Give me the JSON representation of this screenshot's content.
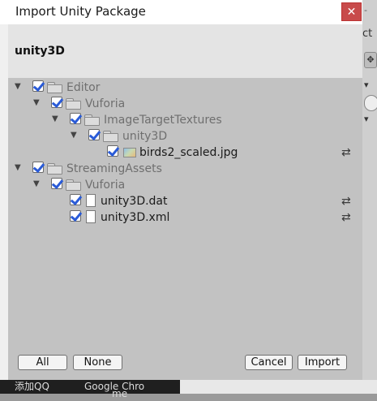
{
  "background": {
    "title_partial": "- ",
    "text_partial": "ct",
    "icon": "move-tool-icon",
    "taskbar": {
      "item_qq": "添加QQ",
      "item_chrome": "Google Chro",
      "item_chrome2": "me"
    }
  },
  "dialog": {
    "title": "Import Unity Package",
    "close_icon": "✕",
    "package_name": "unity3D",
    "tree": [
      {
        "label": "Editor",
        "type": "folder",
        "depth": 0,
        "expanded": true,
        "checked": true,
        "reimport": false
      },
      {
        "label": "Vuforia",
        "type": "folder",
        "depth": 1,
        "expanded": true,
        "checked": true,
        "reimport": false
      },
      {
        "label": "ImageTargetTextures",
        "type": "folder",
        "depth": 2,
        "expanded": true,
        "checked": true,
        "reimport": false
      },
      {
        "label": "unity3D",
        "type": "folder",
        "depth": 3,
        "expanded": true,
        "checked": true,
        "reimport": false
      },
      {
        "label": "birds2_scaled.jpg",
        "type": "image",
        "depth": 4,
        "expanded": false,
        "checked": true,
        "reimport": true
      },
      {
        "label": "StreamingAssets",
        "type": "folder",
        "depth": 0,
        "expanded": true,
        "checked": true,
        "reimport": false
      },
      {
        "label": "Vuforia",
        "type": "folder",
        "depth": 1,
        "expanded": true,
        "checked": true,
        "reimport": false
      },
      {
        "label": "unity3D.dat",
        "type": "file",
        "depth": 2,
        "expanded": false,
        "checked": true,
        "reimport": true
      },
      {
        "label": "unity3D.xml",
        "type": "file",
        "depth": 2,
        "expanded": false,
        "checked": true,
        "reimport": true
      }
    ],
    "reimport_icon": "⇄",
    "buttons": {
      "all": "All",
      "none": "None",
      "cancel": "Cancel",
      "import": "Import"
    }
  }
}
